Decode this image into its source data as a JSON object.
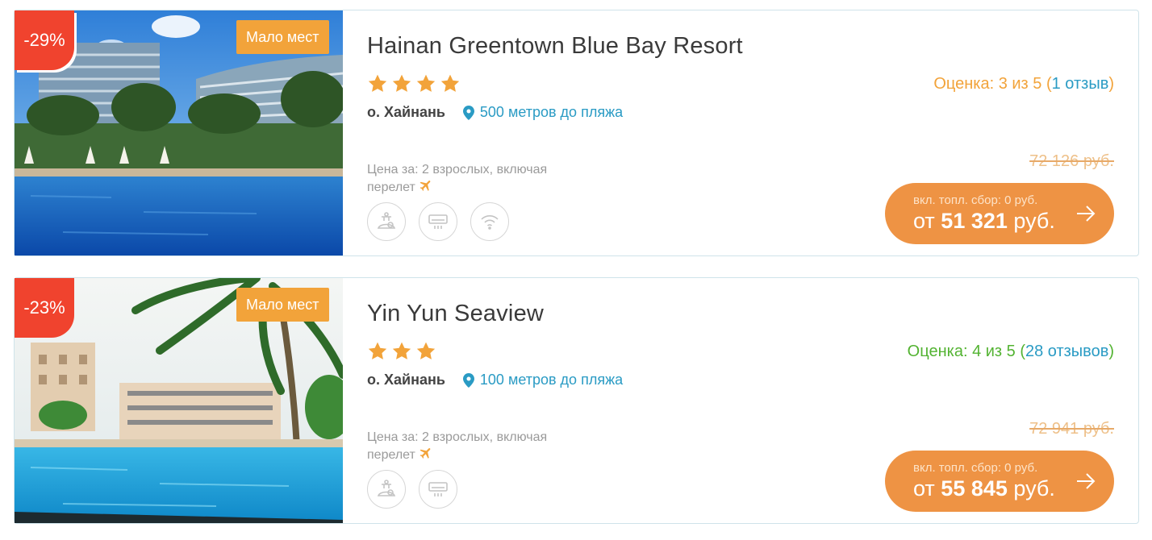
{
  "hotels": [
    {
      "name": "Hainan Greentown Blue Bay Resort",
      "discount": "-29%",
      "badge": "Мало мест",
      "stars": 4,
      "island": "о. Хайнань",
      "beach_distance": "500 метров до пляжа",
      "price_line1": "Цена за: 2 взрослых, включая",
      "price_line2": "перелет",
      "rating": {
        "prefix": "Оценка: ",
        "score": "3",
        "middle": " из 5 (",
        "reviews": "1 отзыв",
        "suffix": ")",
        "color": "#f2a33a"
      },
      "old_price": "72 126 руб.",
      "fee": "вкл. топл. сбор: 0 руб.",
      "price_from": "от ",
      "price": "51 321",
      "currency": " руб.",
      "amenities": [
        "spa-icon",
        "air-conditioner-icon",
        "wifi-icon"
      ]
    },
    {
      "name": "Yin Yun Seaview",
      "discount": "-23%",
      "badge": "Мало мест",
      "stars": 3,
      "island": "о. Хайнань",
      "beach_distance": "100 метров до пляжа",
      "price_line1": "Цена за: 2 взрослых, включая",
      "price_line2": "перелет",
      "rating": {
        "prefix": "Оценка: ",
        "score": "4",
        "middle": " из 5 (",
        "reviews": "28 отзывов",
        "suffix": ")",
        "color": "#53b332"
      },
      "old_price": "72 941 руб.",
      "fee": "вкл. топл. сбор: 0 руб.",
      "price_from": "от ",
      "price": "55 845",
      "currency": " руб.",
      "amenities": [
        "spa-icon",
        "air-conditioner-icon"
      ]
    }
  ],
  "colors": {
    "accent": "#ee9344",
    "discount": "#f0432e",
    "badge": "#f2a33a",
    "link": "#2a9bc4",
    "star": "#f2a33a"
  }
}
